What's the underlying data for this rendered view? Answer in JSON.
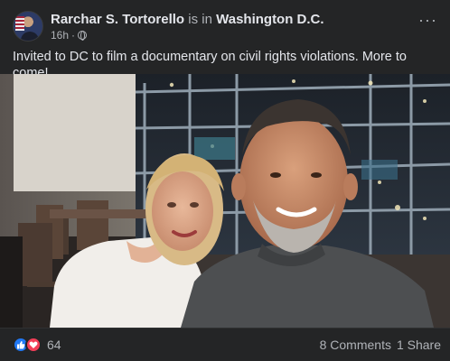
{
  "post": {
    "author": "Rarchar S. Tortorello",
    "is_in_text": "is in",
    "location": "Washington D.C.",
    "time": "16h",
    "separator": "·",
    "more_label": "···",
    "body": "Invited to DC to film a documentary on civil rights violations. More to come!"
  },
  "footer": {
    "reaction_icons": [
      "like-icon",
      "love-icon"
    ],
    "reaction_count": "64",
    "comments": "8 Comments",
    "shares": "1 Share"
  },
  "colors": {
    "background": "#242526",
    "text_primary": "#e4e6eb",
    "text_secondary": "#b0b3b8",
    "like": "#2078f4",
    "love": "#f33e58"
  }
}
